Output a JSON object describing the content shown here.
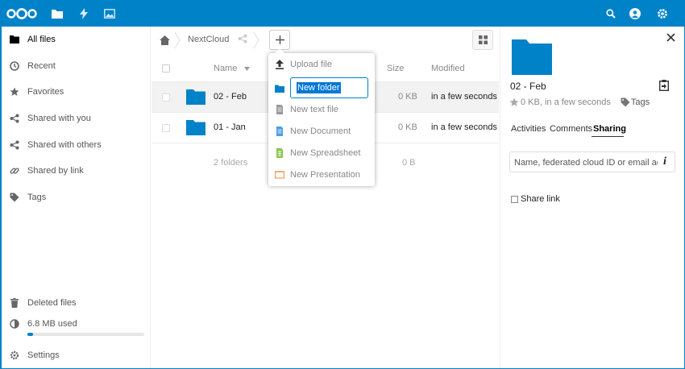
{
  "header": {
    "icons": [
      "logo-icon",
      "files-icon",
      "activity-icon",
      "gallery-icon",
      "search-icon",
      "contacts-icon",
      "settings-icon"
    ]
  },
  "sidebar": {
    "items": [
      {
        "label": "All files",
        "icon": "folder-icon"
      },
      {
        "label": "Recent",
        "icon": "clock-icon"
      },
      {
        "label": "Favorites",
        "icon": "star-icon"
      },
      {
        "label": "Shared with you",
        "icon": "share-icon"
      },
      {
        "label": "Shared with others",
        "icon": "share-icon"
      },
      {
        "label": "Shared by link",
        "icon": "link-icon"
      },
      {
        "label": "Tags",
        "icon": "tag-icon"
      }
    ],
    "deleted_label": "Deleted files",
    "quota_label": "6.8 MB used",
    "quota_fraction": 0.05,
    "settings_label": "Settings"
  },
  "breadcrumb": {
    "root": "NextCloud"
  },
  "table": {
    "headers": {
      "name": "Name",
      "size": "Size",
      "modified": "Modified"
    },
    "rows": [
      {
        "name": "02 - Feb",
        "size": "0 KB",
        "modified": "in a few seconds"
      },
      {
        "name": "01 - Jan",
        "size": "0 KB",
        "modified": "in a few seconds"
      }
    ],
    "summary": {
      "count": "2 folders",
      "size": "0 B"
    }
  },
  "new_menu": {
    "upload": "Upload file",
    "folder_input": "New folder",
    "text": "New text file",
    "document": "New Document",
    "spreadsheet": "New Spreadsheet",
    "presentation": "New Presentation"
  },
  "detail": {
    "name": "02 - Feb",
    "meta": "0 KB, in a few seconds",
    "tags_label": "Tags",
    "tabs": [
      "Activities",
      "Comments",
      "Sharing"
    ],
    "active_tab": "Sharing",
    "share_placeholder": "Name, federated cloud ID or email ad...",
    "share_link_label": "Share link"
  },
  "colors": {
    "brand": "#0082c9",
    "doc": "#4a9ee5",
    "sheet": "#8bc34a",
    "slides": "#f39c5a"
  }
}
